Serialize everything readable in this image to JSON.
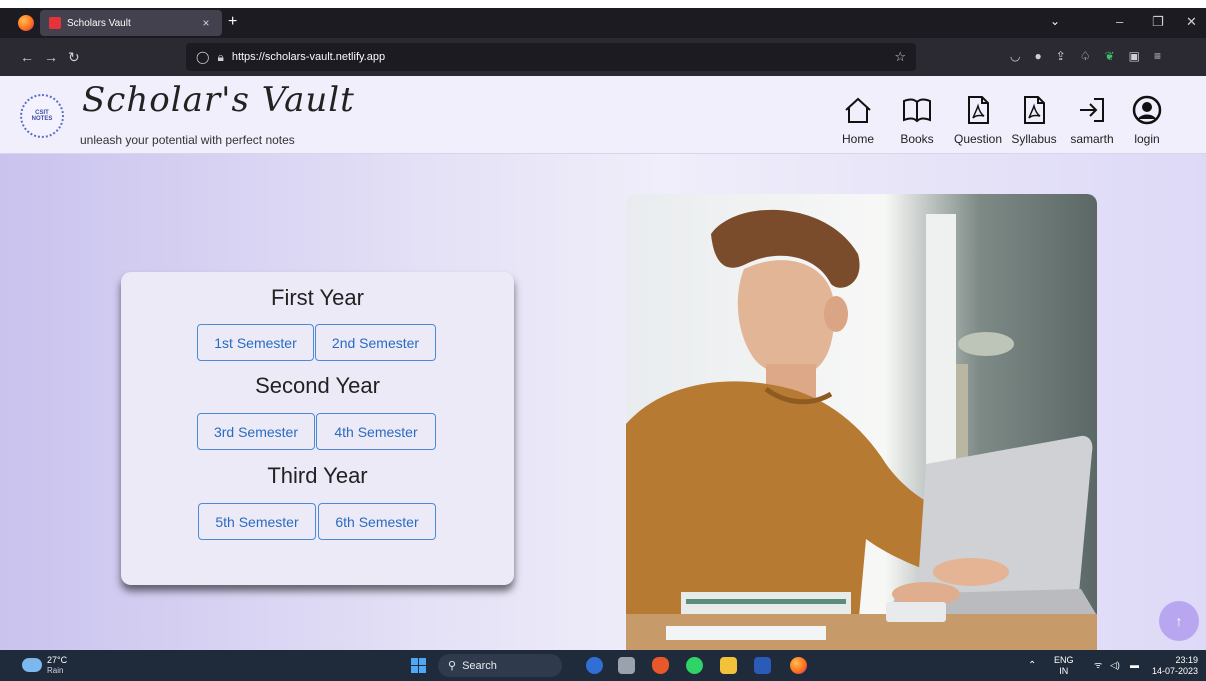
{
  "browser": {
    "tab_title": "Scholars Vault",
    "tab_close": "×",
    "new_tab": "+",
    "url": "https://scholars-vault.netlify.app",
    "window_controls": [
      "⌄",
      "–",
      "❐",
      "✕"
    ]
  },
  "site": {
    "title": "Scholar's Vault",
    "tagline": "unleash your potential with perfect notes",
    "logo_text": "CSIT NOTES",
    "nav": [
      {
        "label": "Home",
        "icon": "home-icon"
      },
      {
        "label": "Books",
        "icon": "book-icon"
      },
      {
        "label": "Question",
        "icon": "pdf-icon"
      },
      {
        "label": "Syllabus",
        "icon": "pdf-icon"
      },
      {
        "label": "samarth",
        "icon": "sign-in-icon"
      },
      {
        "label": "login",
        "icon": "user-circle-icon"
      }
    ]
  },
  "years": [
    {
      "title": "First Year",
      "semesters": [
        "1st Semester",
        "2nd Semester"
      ]
    },
    {
      "title": "Second Year",
      "semesters": [
        "3rd Semester",
        "4th Semester"
      ]
    },
    {
      "title": "Third Year",
      "semesters": [
        "5th Semester",
        "6th Semester"
      ]
    }
  ],
  "scroll_top_label": "↑",
  "taskbar": {
    "weather_temp": "27°C",
    "weather_desc": "Rain",
    "search_label": "Search",
    "lang_top": "ENG",
    "lang_bottom": "IN",
    "time": "23:19",
    "date": "14-07-2023"
  },
  "colors": {
    "accent": "#2a6bc1",
    "card_bg": "#eceaf7",
    "page_gradient_left": "#c9c3ee",
    "scroll_button": "#b8a7f0"
  }
}
